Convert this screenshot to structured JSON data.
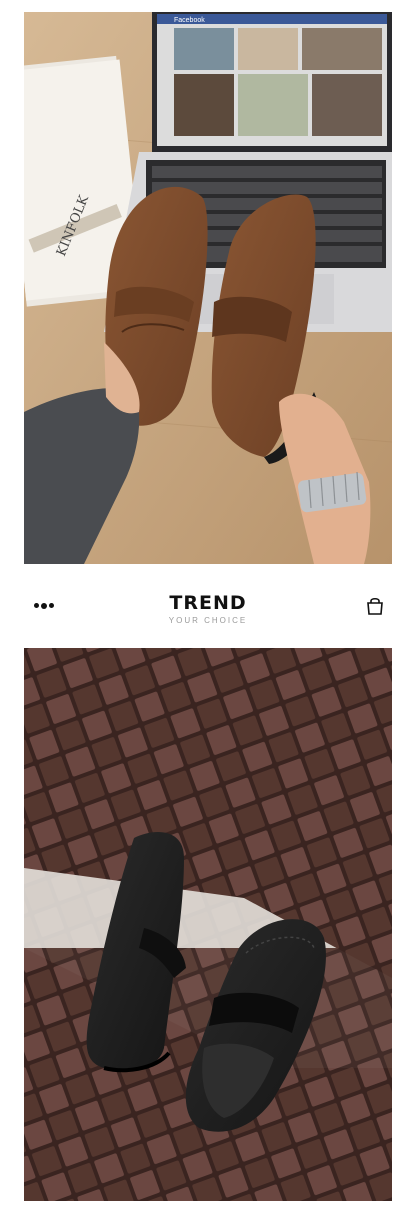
{
  "trend_bar": {
    "title": "TREND",
    "subtitle": "YOUR CHOICE",
    "menu_icon": "dots-menu-icon",
    "bag_icon": "shopping-bag-icon"
  },
  "top_photo": {
    "laptop_screen_label": "Facebook",
    "book_spine_text": "KINFOLK",
    "shoe_color": "#7a4a2a"
  },
  "bottom_photo": {
    "shoe_color": "#1c1c1c",
    "weave_color": "#5a3a33"
  }
}
